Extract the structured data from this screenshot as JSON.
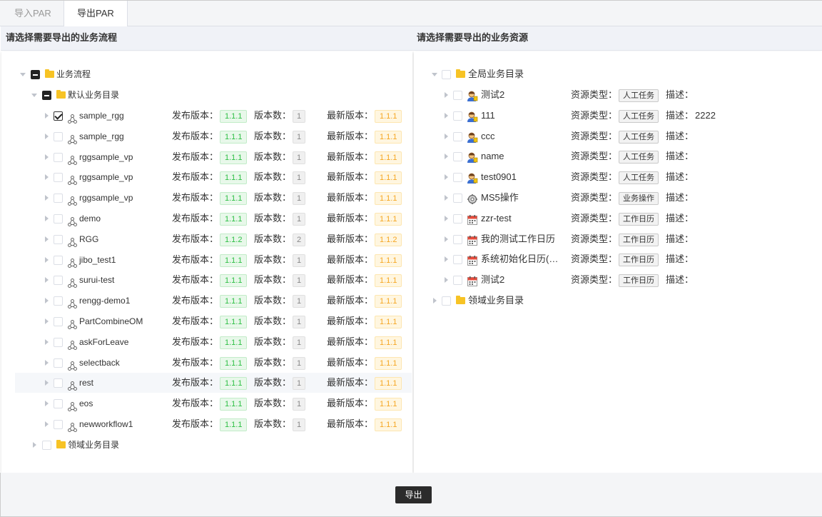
{
  "tabs": [
    {
      "label": "导入PAR",
      "active": false
    },
    {
      "label": "导出PAR",
      "active": true
    }
  ],
  "left": {
    "title": "请选择需要导出的业务流程",
    "root": {
      "label": "业务流程"
    },
    "default_dir": {
      "label": "默认业务目录"
    },
    "field_publish": "发布版本：",
    "field_count": "版本数：",
    "field_latest": "最新版本：",
    "processes": [
      {
        "name": "sample_rgg",
        "publish": "1.1.1",
        "count": "1",
        "latest": "1.1.1",
        "checked": true
      },
      {
        "name": "sample_rgg",
        "publish": "1.1.1",
        "count": "1",
        "latest": "1.1.1",
        "checked": false
      },
      {
        "name": "rggsample_vp",
        "publish": "1.1.1",
        "count": "1",
        "latest": "1.1.1",
        "checked": false
      },
      {
        "name": "rggsample_vp",
        "publish": "1.1.1",
        "count": "1",
        "latest": "1.1.1",
        "checked": false
      },
      {
        "name": "rggsample_vp",
        "publish": "1.1.1",
        "count": "1",
        "latest": "1.1.1",
        "checked": false
      },
      {
        "name": "demo",
        "publish": "1.1.1",
        "count": "1",
        "latest": "1.1.1",
        "checked": false
      },
      {
        "name": "RGG",
        "publish": "1.1.2",
        "count": "2",
        "latest": "1.1.2",
        "checked": false
      },
      {
        "name": "jibo_test1",
        "publish": "1.1.1",
        "count": "1",
        "latest": "1.1.1",
        "checked": false
      },
      {
        "name": "surui-test",
        "publish": "1.1.1",
        "count": "1",
        "latest": "1.1.1",
        "checked": false
      },
      {
        "name": "rengg-demo1",
        "publish": "1.1.1",
        "count": "1",
        "latest": "1.1.1",
        "checked": false
      },
      {
        "name": "PartCombineOM",
        "publish": "1.1.1",
        "count": "1",
        "latest": "1.1.1",
        "checked": false
      },
      {
        "name": "askForLeave",
        "publish": "1.1.1",
        "count": "1",
        "latest": "1.1.1",
        "checked": false
      },
      {
        "name": "selectback",
        "publish": "1.1.1",
        "count": "1",
        "latest": "1.1.1",
        "checked": false
      },
      {
        "name": "rest",
        "publish": "1.1.1",
        "count": "1",
        "latest": "1.1.1",
        "checked": false
      },
      {
        "name": "eos",
        "publish": "1.1.1",
        "count": "1",
        "latest": "1.1.1",
        "checked": false
      },
      {
        "name": "newworkflow1",
        "publish": "1.1.1",
        "count": "1",
        "latest": "1.1.1",
        "checked": false
      }
    ],
    "domain_dir": {
      "label": "领域业务目录"
    }
  },
  "right": {
    "title": "请选择需要导出的业务资源",
    "global_dir": {
      "label": "全局业务目录"
    },
    "field_type": "资源类型：",
    "field_desc": "描述：",
    "resources": [
      {
        "name": "测试2",
        "icon": "person-icon",
        "type": "人工任务",
        "desc": ""
      },
      {
        "name": "111",
        "icon": "person-icon",
        "type": "人工任务",
        "desc": "2222"
      },
      {
        "name": "ccc",
        "icon": "person-icon",
        "type": "人工任务",
        "desc": ""
      },
      {
        "name": "name",
        "icon": "person-icon",
        "type": "人工任务",
        "desc": ""
      },
      {
        "name": "test0901",
        "icon": "person-icon",
        "type": "人工任务",
        "desc": ""
      },
      {
        "name": "MS5操作",
        "icon": "gear-icon",
        "type": "业务操作",
        "desc": ""
      },
      {
        "name": "zzr-test",
        "icon": "calendar-icon",
        "type": "工作日历",
        "desc": ""
      },
      {
        "name": "我的测试工作日历",
        "icon": "calendar-icon",
        "type": "工作日历",
        "desc": ""
      },
      {
        "name": "系统初始化日历(…",
        "icon": "calendar-icon",
        "type": "工作日历",
        "desc": ""
      },
      {
        "name": "测试2",
        "icon": "calendar-icon",
        "type": "工作日历",
        "desc": ""
      }
    ],
    "domain_dir": {
      "label": "领域业务目录"
    }
  },
  "footer": {
    "export_label": "导出"
  },
  "colors": {
    "green": "#2ebf45",
    "yellow": "#f5a623",
    "folder": "#f7c325",
    "button": "#2b2b2b"
  }
}
